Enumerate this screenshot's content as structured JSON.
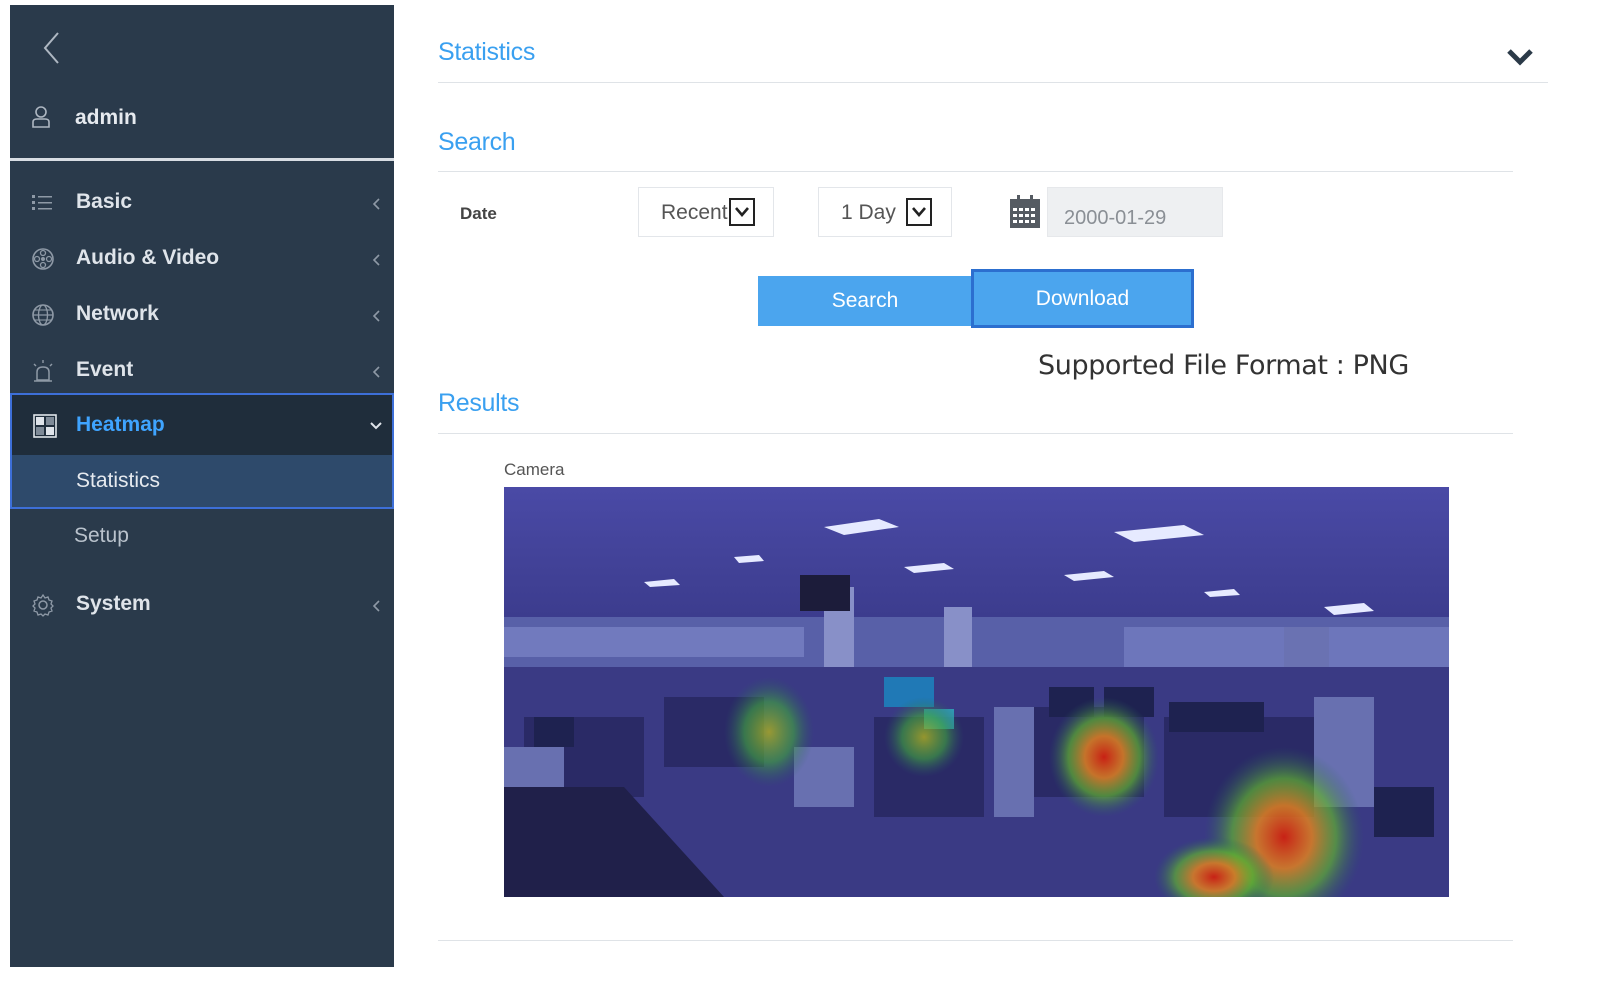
{
  "sidebar": {
    "user": {
      "name": "admin"
    },
    "items": [
      {
        "label": "Basic",
        "icon": "list-icon"
      },
      {
        "label": "Audio & Video",
        "icon": "film-reel-icon"
      },
      {
        "label": "Network",
        "icon": "globe-icon"
      },
      {
        "label": "Event",
        "icon": "alarm-icon"
      },
      {
        "label": "Heatmap",
        "icon": "heatmap-icon",
        "active": true
      },
      {
        "label": "System",
        "icon": "gear-icon"
      }
    ],
    "heatmap_sub": [
      {
        "label": "Statistics",
        "active": true
      },
      {
        "label": "Setup"
      }
    ]
  },
  "header": {
    "title": "Statistics"
  },
  "search": {
    "title": "Search",
    "date_label": "Date",
    "period_select": "Recent",
    "range_select": "1 Day",
    "date_value": "2000-01-29",
    "search_button": "Search",
    "download_button": "Download",
    "format_note": "Supported File Format : PNG"
  },
  "results": {
    "title": "Results",
    "camera_label": "Camera"
  },
  "colors": {
    "sidebar_bg": "#2a3a4b",
    "accent": "#3aa0f0",
    "button": "#4ba5ee",
    "active_border": "#3d6fd8"
  }
}
